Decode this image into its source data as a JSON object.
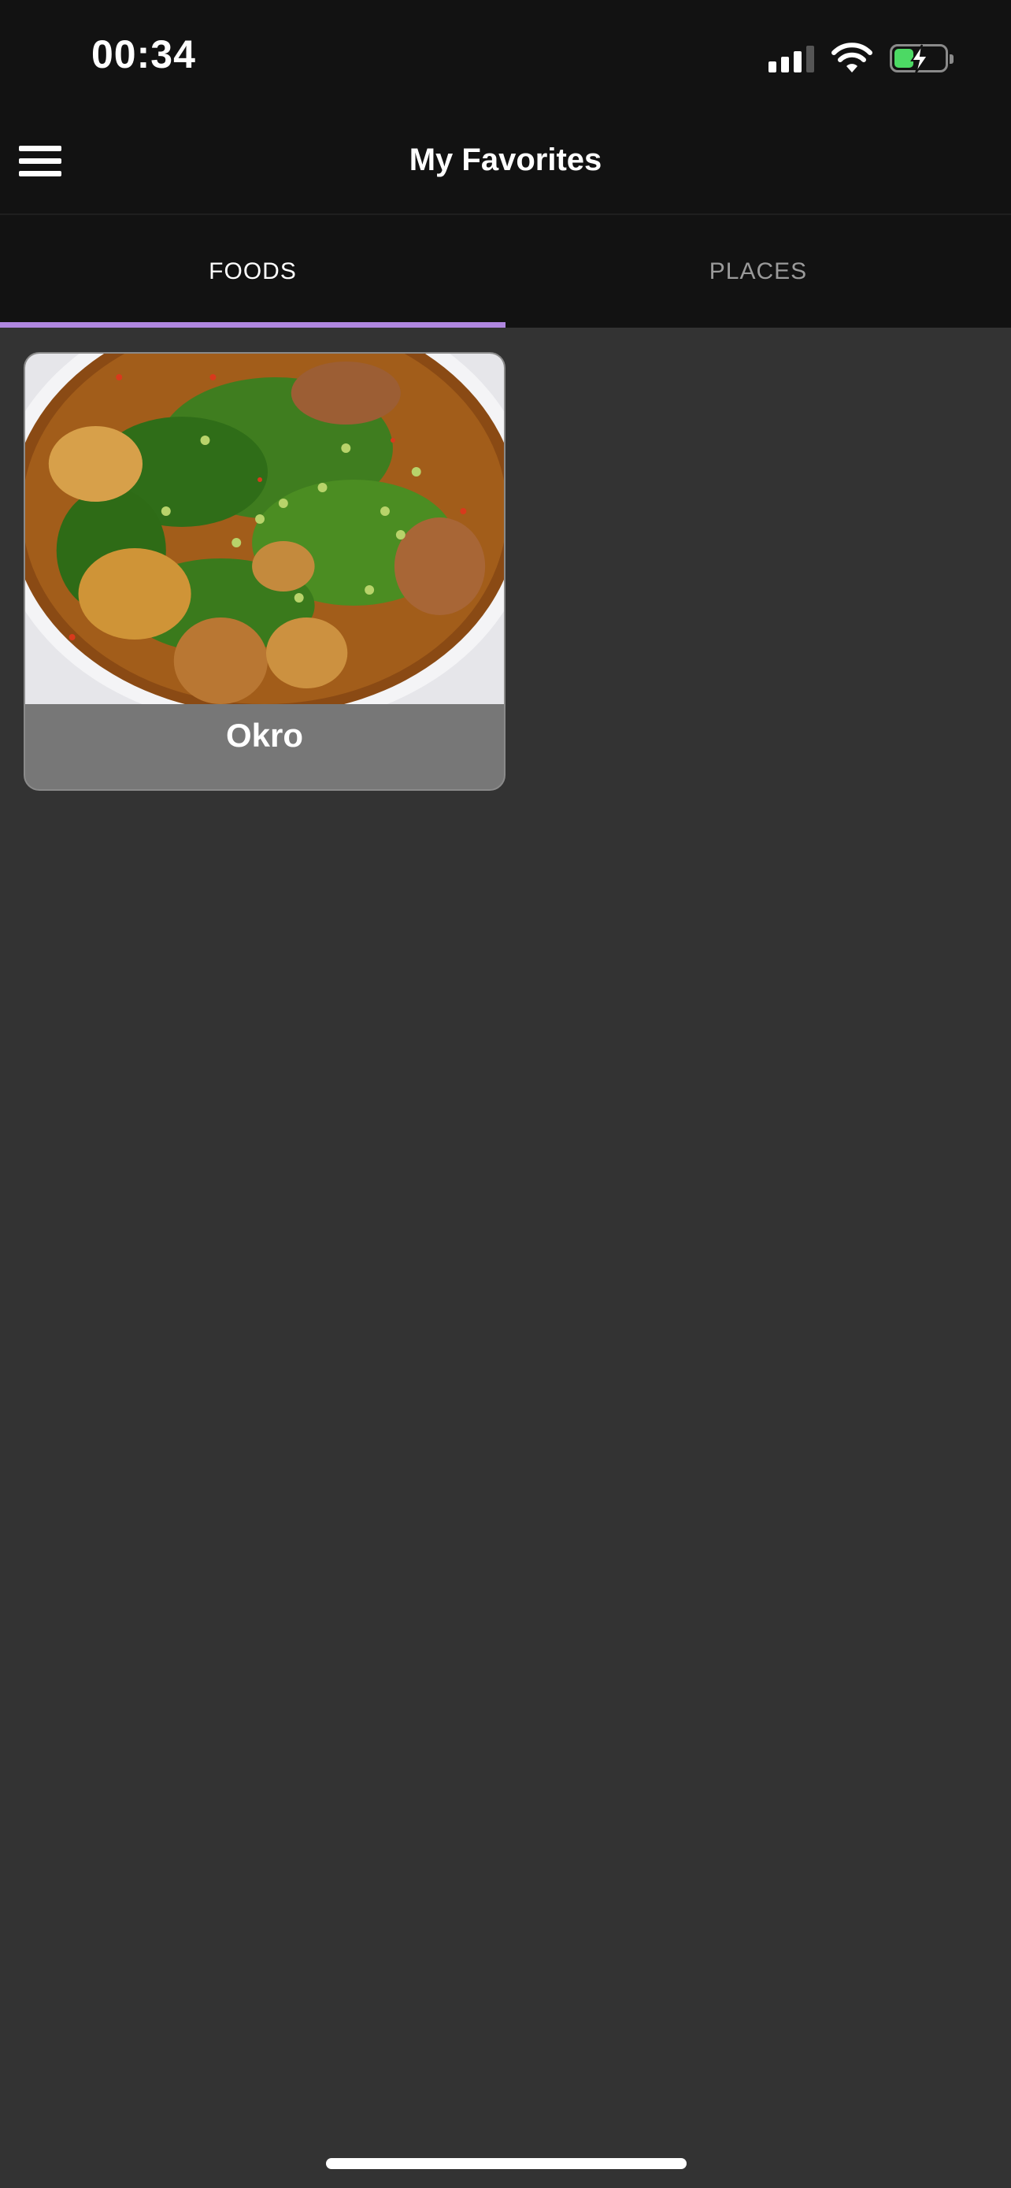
{
  "status_bar": {
    "time": "00:34"
  },
  "header": {
    "title": "My Favorites"
  },
  "tabs": [
    {
      "label": "FOODS",
      "active": true
    },
    {
      "label": "PLACES",
      "active": false
    }
  ],
  "favorites": [
    {
      "name": "Okro"
    }
  ],
  "colors": {
    "accent": "#b087e0",
    "background": "#333333",
    "bar": "#121212",
    "card_caption": "#777777"
  }
}
